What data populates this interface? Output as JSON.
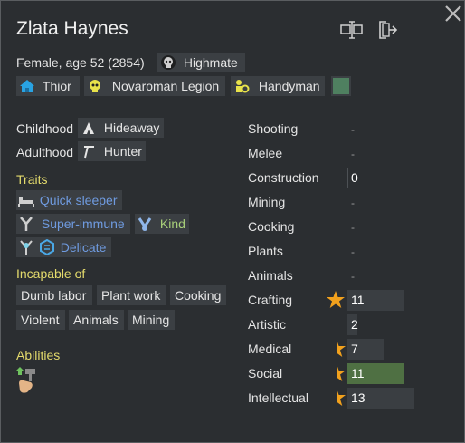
{
  "colors": {
    "panel_bg": "#2b2e31",
    "chip_bg": "#3b3f43",
    "section_header": "#e3da6c",
    "trait_blue": "#6f9be0",
    "trait_green": "#a8cf7a",
    "ideo_color_swatch": "#4f8060",
    "social_bar": "#4f7043",
    "passion_orange": "#f2a11d"
  },
  "header": {
    "name": "Zlata Haynes",
    "subtitle": "Female, age 52 (2854)",
    "buttons": {
      "rename_icon": "rename-icon",
      "banish_icon": "exit-door-icon",
      "close_icon": "close-x-icon"
    }
  },
  "badges": {
    "title": "Highmate",
    "title_icon": "crown-skull-icon",
    "faction": "Thior",
    "faction_icon": "house-icon",
    "ideology": "Novaroman Legion",
    "ideology_icon": "skull-icon",
    "role": "Handyman",
    "role_icon": "gear-worker-icon"
  },
  "backstory": {
    "childhood_label": "Childhood",
    "childhood_value": "Hideaway",
    "adulthood_label": "Adulthood",
    "adulthood_value": "Hunter"
  },
  "traits": {
    "header": "Traits",
    "items": [
      {
        "label": "Quick sleeper",
        "icon": "bed-icon"
      },
      {
        "label": "Super-immune",
        "icon": "immune-y-icon"
      },
      {
        "label": "Kind",
        "icon": "hands-heart-icon"
      },
      {
        "label": "Delicate",
        "icon": "delicate-icon"
      }
    ]
  },
  "incapable": {
    "header": "Incapable of",
    "items": [
      "Dumb labor",
      "Plant work",
      "Cooking",
      "Violent",
      "Animals",
      "Mining"
    ]
  },
  "abilities": {
    "header": "Abilities",
    "icon": "hammer-hand-icon"
  },
  "skills": [
    {
      "name": "Shooting",
      "value": "-",
      "level": null,
      "passion": "none"
    },
    {
      "name": "Melee",
      "value": "-",
      "level": null,
      "passion": "none"
    },
    {
      "name": "Construction",
      "value": "0",
      "level": 0,
      "passion": "none"
    },
    {
      "name": "Mining",
      "value": "-",
      "level": null,
      "passion": "none"
    },
    {
      "name": "Cooking",
      "value": "-",
      "level": null,
      "passion": "none"
    },
    {
      "name": "Plants",
      "value": "-",
      "level": null,
      "passion": "none"
    },
    {
      "name": "Animals",
      "value": "-",
      "level": null,
      "passion": "none"
    },
    {
      "name": "Crafting",
      "value": "11",
      "level": 11,
      "passion": "major"
    },
    {
      "name": "Artistic",
      "value": "2",
      "level": 2,
      "passion": "none"
    },
    {
      "name": "Medical",
      "value": "7",
      "level": 7,
      "passion": "minor"
    },
    {
      "name": "Social",
      "value": "11",
      "level": 11,
      "passion": "minor"
    },
    {
      "name": "Intellectual",
      "value": "13",
      "level": 13,
      "passion": "minor"
    }
  ]
}
